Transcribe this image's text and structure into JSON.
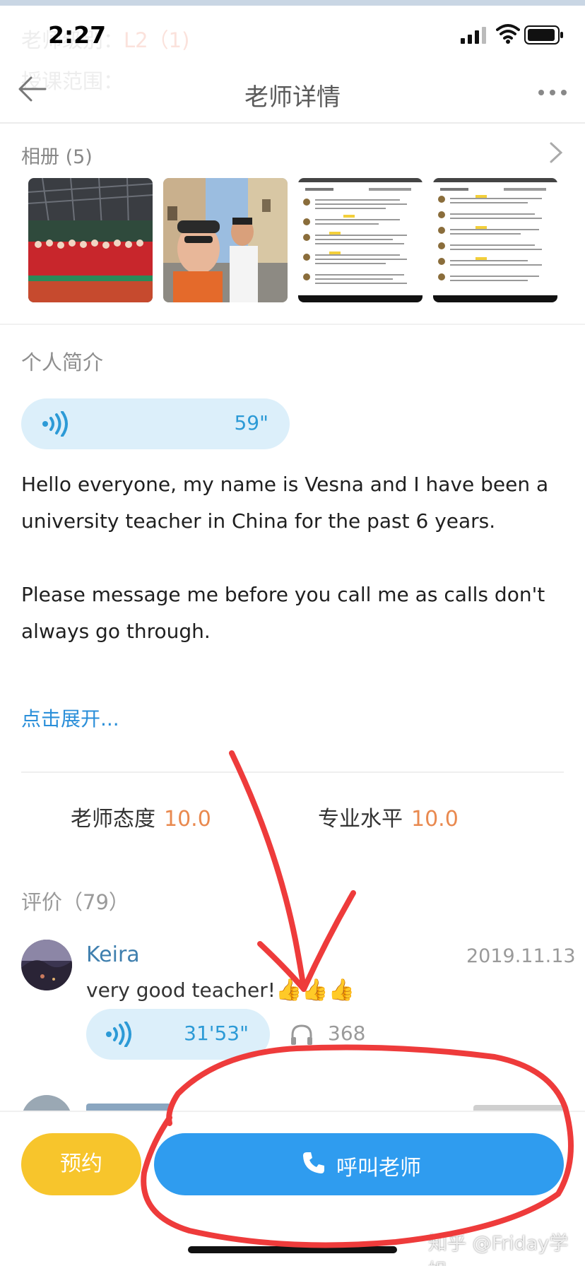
{
  "status_bar": {
    "time": "2:27"
  },
  "behind_text": {
    "level_label": "老师级别：",
    "level_value": "L2（1)",
    "scope_label": "授课范围："
  },
  "nav": {
    "title": "老师详情"
  },
  "album": {
    "title": "相册 (5)"
  },
  "intro": {
    "title": "个人简介",
    "voice_duration": "59\"",
    "paragraph1": "Hello everyone, my name is Vesna and I have been a university teacher in China for the past 6 years.",
    "paragraph2": "Please message me before you call me as calls don't always go through.",
    "expand_link": "点击展开..."
  },
  "ratings": {
    "attitude_label": "老师态度",
    "attitude_value": "10.0",
    "skill_label": "专业水平",
    "skill_value": "10.0"
  },
  "reviews": {
    "title": "评价（79）",
    "items": [
      {
        "name": "Keira",
        "date": "2019.11.13",
        "text": "very good teacher!",
        "emoji": "👍👍👍",
        "voice_duration": "31'53\"",
        "listens": "368"
      }
    ]
  },
  "actions": {
    "book_label": "预约",
    "call_label": "呼叫老师"
  },
  "watermark": "知乎 @Friday学姐",
  "colors": {
    "accent_blue": "#2f9cef",
    "book_yellow": "#f7c52c",
    "rating_orange": "#e9894f",
    "link_blue": "#2b8fd9",
    "voice_bg": "#dceffa",
    "annotation_red": "#ee3b3b"
  }
}
